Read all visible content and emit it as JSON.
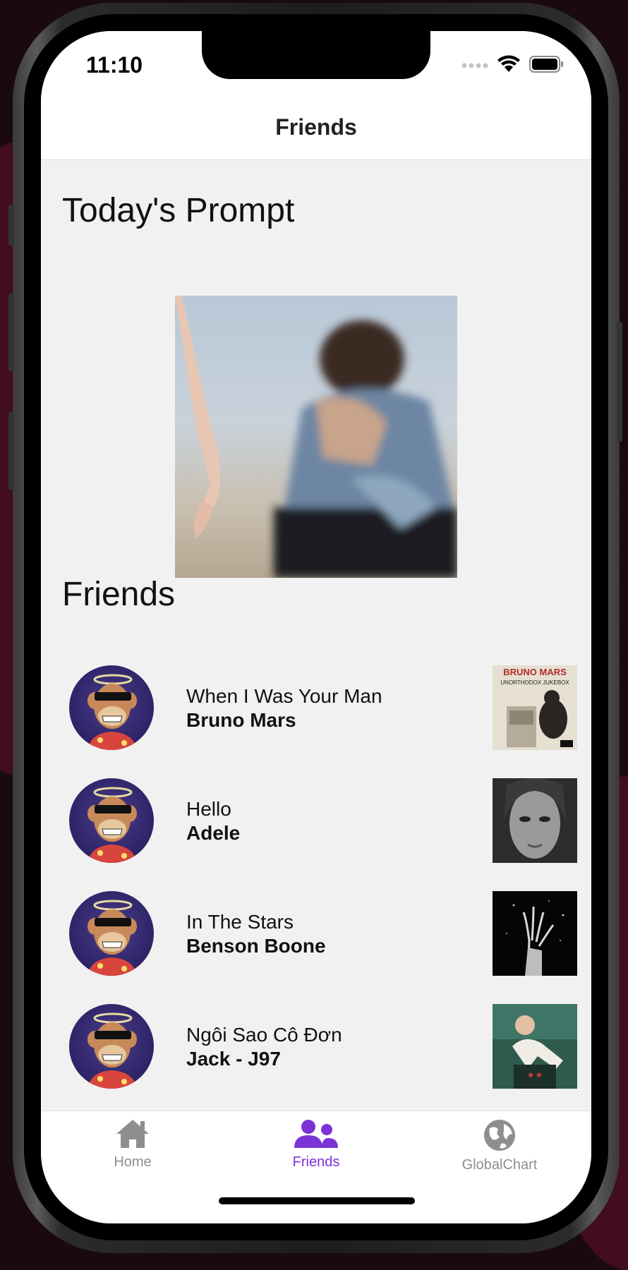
{
  "status_bar": {
    "time": "11:10"
  },
  "nav": {
    "title": "Friends"
  },
  "prompt": {
    "heading": "Today's Prompt"
  },
  "friends_section": {
    "heading": "Friends"
  },
  "friends": [
    {
      "song": "When I Was Your Man",
      "artist": "Bruno Mars",
      "cover_text": "BRUNO MARS",
      "cover_sub": "UNORTHODOX JUKEBOX"
    },
    {
      "song": "Hello",
      "artist": "Adele"
    },
    {
      "song": "In The Stars",
      "artist": "Benson Boone"
    },
    {
      "song": "Ngôi Sao Cô Đơn",
      "artist": "Jack - J97"
    },
    {
      "song": "",
      "artist": ""
    }
  ],
  "tabs": [
    {
      "label": "Home",
      "icon": "home-icon",
      "active": false
    },
    {
      "label": "Friends",
      "icon": "users-icon",
      "active": true
    },
    {
      "label": "GlobalChart",
      "icon": "globe-icon",
      "active": false
    }
  ],
  "colors": {
    "accent": "#7b32d6",
    "inactive_tab": "#8e8e8e",
    "screen_bg": "#f1f1f2"
  }
}
